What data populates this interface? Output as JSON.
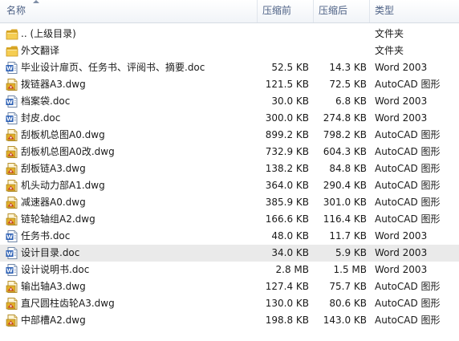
{
  "columns": {
    "name": "名称",
    "original_size": "压缩前",
    "compressed_size": "压缩后",
    "type": "类型"
  },
  "files": [
    {
      "name": ".. (上级目录)",
      "original_size": "",
      "compressed_size": "",
      "type": "文件夹",
      "icon": "folder-icon"
    },
    {
      "name": "外文翻译",
      "original_size": "",
      "compressed_size": "",
      "type": "文件夹",
      "icon": "folder-icon"
    },
    {
      "name": "毕业设计扉页、任务书、评阅书、摘要.doc",
      "original_size": "52.5 KB",
      "compressed_size": "14.3 KB",
      "type": "Word 2003",
      "icon": "word-doc-icon"
    },
    {
      "name": "拨链器A3.dwg",
      "original_size": "121.5 KB",
      "compressed_size": "72.5 KB",
      "type": "AutoCAD 图形",
      "icon": "dwg-file-icon"
    },
    {
      "name": "档案袋.doc",
      "original_size": "30.0 KB",
      "compressed_size": "6.8 KB",
      "type": "Word 2003",
      "icon": "word-doc-icon"
    },
    {
      "name": "封皮.doc",
      "original_size": "300.0 KB",
      "compressed_size": "274.8 KB",
      "type": "Word 2003",
      "icon": "word-doc-icon"
    },
    {
      "name": "刮板机总图A0.dwg",
      "original_size": "899.2 KB",
      "compressed_size": "798.2 KB",
      "type": "AutoCAD 图形",
      "icon": "dwg-file-icon"
    },
    {
      "name": "刮板机总图A0改.dwg",
      "original_size": "732.9 KB",
      "compressed_size": "604.3 KB",
      "type": "AutoCAD 图形",
      "icon": "dwg-file-icon"
    },
    {
      "name": "刮板链A3.dwg",
      "original_size": "138.2 KB",
      "compressed_size": "84.8 KB",
      "type": "AutoCAD 图形",
      "icon": "dwg-file-icon"
    },
    {
      "name": "机头动力部A1.dwg",
      "original_size": "364.0 KB",
      "compressed_size": "290.4 KB",
      "type": "AutoCAD 图形",
      "icon": "dwg-file-icon"
    },
    {
      "name": "减速器A0.dwg",
      "original_size": "385.9 KB",
      "compressed_size": "301.0 KB",
      "type": "AutoCAD 图形",
      "icon": "dwg-file-icon"
    },
    {
      "name": "链轮轴组A2.dwg",
      "original_size": "166.6 KB",
      "compressed_size": "116.4 KB",
      "type": "AutoCAD 图形",
      "icon": "dwg-file-icon"
    },
    {
      "name": "任务书.doc",
      "original_size": "48.0 KB",
      "compressed_size": "11.7 KB",
      "type": "Word 2003",
      "icon": "word-doc-icon"
    },
    {
      "name": "设计目录.doc",
      "original_size": "34.0 KB",
      "compressed_size": "5.9 KB",
      "type": "Word 2003",
      "icon": "word-doc-icon",
      "selected": true
    },
    {
      "name": "设计说明书.doc",
      "original_size": "2.8 MB",
      "compressed_size": "1.5 MB",
      "type": "Word 2003",
      "icon": "word-doc-icon"
    },
    {
      "name": "输出轴A3.dwg",
      "original_size": "127.4 KB",
      "compressed_size": "75.7 KB",
      "type": "AutoCAD 图形",
      "icon": "dwg-file-icon"
    },
    {
      "name": "直尺圆柱齿轮A3.dwg",
      "original_size": "130.0 KB",
      "compressed_size": "80.6 KB",
      "type": "AutoCAD 图形",
      "icon": "dwg-file-icon"
    },
    {
      "name": "中部槽A2.dwg",
      "original_size": "198.8 KB",
      "compressed_size": "143.0 KB",
      "type": "AutoCAD 图形",
      "icon": "dwg-file-icon"
    }
  ]
}
